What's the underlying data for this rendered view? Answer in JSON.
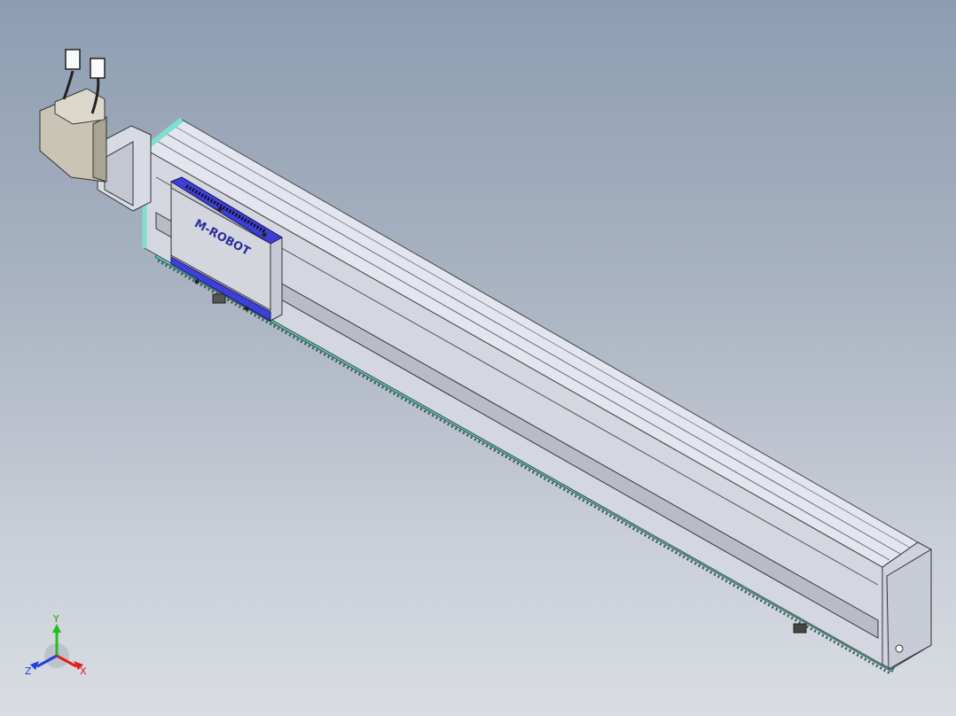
{
  "viewport": {
    "background_top": "#8d9db2",
    "background_bottom": "#d9dde3"
  },
  "model": {
    "carriage_logo_text": "M-ROBOT",
    "colors": {
      "profile": "#d6d9e3",
      "edge_accent": "#7fe0cf",
      "carriage_plate": "#3d3fd6",
      "motor_body": "#c9c4b4"
    }
  },
  "triad": {
    "x_label": "X",
    "y_label": "Y",
    "z_label": "Z",
    "x_color": "#e02020",
    "y_color": "#20c020",
    "z_color": "#2040e0"
  }
}
